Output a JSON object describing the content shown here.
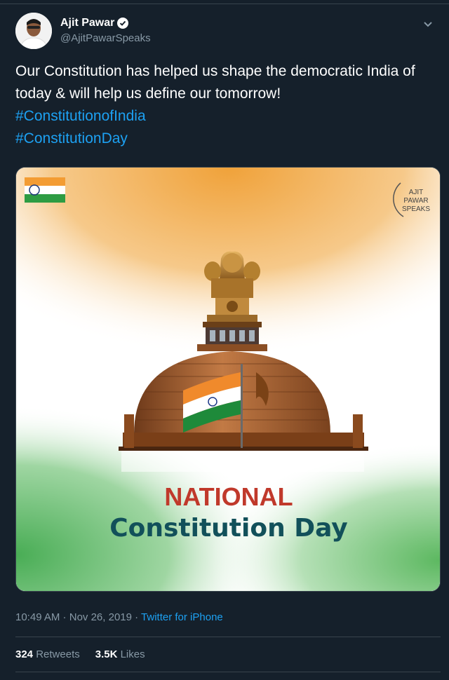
{
  "user": {
    "name": "Ajit Pawar",
    "handle": "@AjitPawarSpeaks"
  },
  "tweet": {
    "text": "Our Constitution has helped us shape the democratic India of today & will help us define our tomorrow!",
    "hashtags": [
      "#ConstitutionofIndia",
      "#ConstitutionDay"
    ]
  },
  "media": {
    "watermark_lines": [
      "AJIT",
      "PAWAR",
      "SPEAKS"
    ],
    "headline_top": "NATIONAL",
    "headline_bottom": "Constitution Day",
    "colors": {
      "saffron": "#f39c33",
      "green": "#4caf50",
      "red_text": "#c0392b",
      "teal_text": "#12505a"
    }
  },
  "meta": {
    "time": "10:49 AM",
    "separator": " · ",
    "date": "Nov 26, 2019",
    "source": "Twitter for iPhone"
  },
  "stats": {
    "retweets_count": "324",
    "retweets_label": "Retweets",
    "likes_count": "3.5K",
    "likes_label": "Likes"
  }
}
